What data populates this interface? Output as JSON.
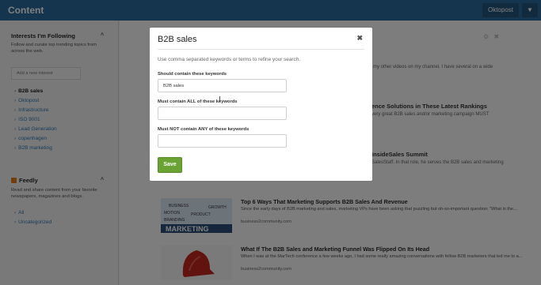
{
  "header": {
    "title": "Content",
    "account_label": "Oktopost",
    "menu_icon": "chevron-down-icon"
  },
  "sidebar": {
    "interests": {
      "heading": "Interests I'm Following",
      "description": "Follow and curate top trending topics from across the web.",
      "input_placeholder": "Add a new interest",
      "items": [
        {
          "label": "B2B sales",
          "active": true
        },
        {
          "label": "Oktopost"
        },
        {
          "label": "Infrastructure"
        },
        {
          "label": "ISO 9001"
        },
        {
          "label": "Lead Generation"
        },
        {
          "label": "copenhagen"
        },
        {
          "label": "B2B marketing"
        }
      ]
    },
    "feedly": {
      "heading": "Feedly",
      "description": "Read and share content from your favorite newspapers, magazines and blogs.",
      "items": [
        {
          "label": "All"
        },
        {
          "label": "Uncategorized"
        }
      ]
    }
  },
  "background": {
    "fragments": [
      "my other videos on my channel. I have several on a wide",
      "ence Solutions in These Latest Rankings",
      "very great B2B sales and/or marketing campaign MUST",
      "InsideSales Summit",
      "SalesStaff. In that role, he serves the B2B sales and marketing"
    ],
    "articles": [
      {
        "title": "Top 6 Ways That Marketing Supports B2B Sales And Revenue",
        "snippet": "Since the early days of B2B marketing and sales, marketing VPs have been asking that puzzling but oh-so-important question: \"What is the...",
        "source": "business2community.com",
        "thumb_words": [
          "BUSINESS",
          "GROWTH",
          "PRODUCT",
          "MOTION",
          "BRANDING",
          "MARKETING"
        ]
      },
      {
        "title": "What If The B2B Sales and Marketing Funnel Was Flipped On Its Head",
        "snippet": "When I was at the MarTech conference a few weeks ago, I had some really amazing conversations with fellow B2B marketers that led me to a...",
        "source": "business2community.com"
      }
    ]
  },
  "modal": {
    "title": "B2B sales",
    "close_icon": "close-icon",
    "instruction": "Use comma separated keywords or terms to refine your search.",
    "fields": [
      {
        "label": "Should contain these keywords",
        "value": "B2B sales"
      },
      {
        "label": "Must contain ALL of these keywords",
        "value": ""
      },
      {
        "label": "Must NOT contain ANY of these keywords",
        "value": ""
      }
    ],
    "save_label": "Save"
  },
  "colors": {
    "header": "#2a6a9c",
    "link": "#2f78b5",
    "save_button": "#6aa334"
  }
}
